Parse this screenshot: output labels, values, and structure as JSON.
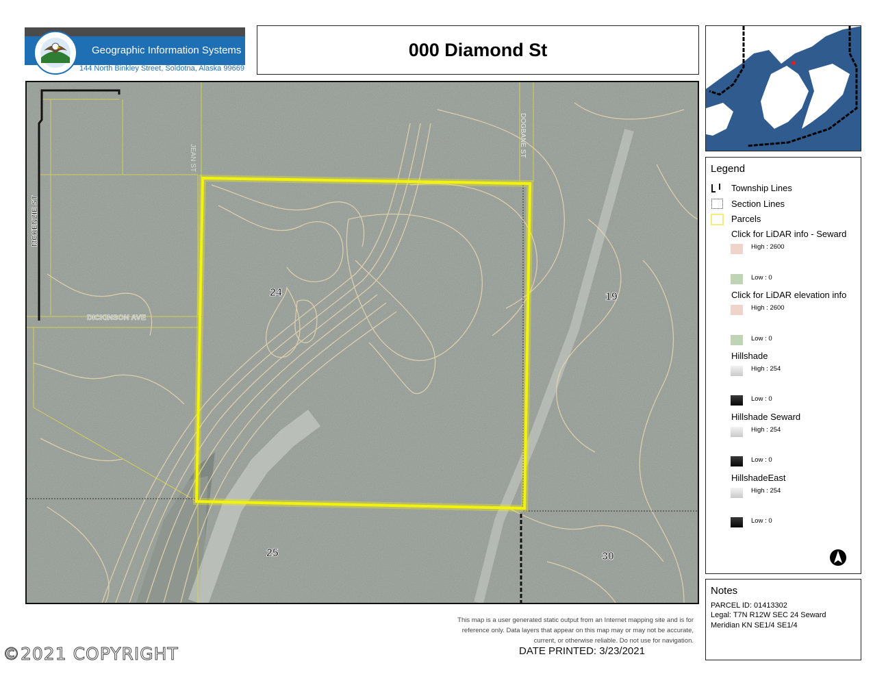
{
  "header": {
    "logo_text": "Geographic Information Systems",
    "address": "144 North Binkley Street, Soldotna, Alaska 99669",
    "seal_text_top": "KENAI PENINSULA",
    "seal_text_bottom": "BOROUGH",
    "title": "000 Diamond St"
  },
  "map": {
    "streets": [
      "JEAN ST",
      "DOGBANE ST",
      "MCKENZIE ST",
      "DICKINSON AVE"
    ],
    "section_labels": [
      "24",
      "19",
      "25",
      "30"
    ],
    "colors": {
      "parcel_highlight": "#f2f20f",
      "parcel_lines": "#d8d84a",
      "contours": "#e8d7b0",
      "terrain": "#8f958f",
      "water": "#2f5b8f"
    }
  },
  "legend": {
    "title": "Legend",
    "items": [
      {
        "label": "Township Lines"
      },
      {
        "label": "Section Lines"
      },
      {
        "label": "Parcels"
      },
      {
        "label": "Click for LiDAR info - Seward",
        "high": "High : 2600",
        "low": "Low : 0"
      },
      {
        "label": "Click for LiDAR elevation info",
        "high": "High : 2600",
        "low": "Low : 0"
      },
      {
        "label": "Hillshade",
        "high": "High : 254",
        "low": "Low : 0"
      },
      {
        "label": "Hillshade Seward",
        "high": "High : 254",
        "low": "Low : 0"
      },
      {
        "label": "HillshadeEast",
        "high": "High : 254",
        "low": "Low : 0"
      }
    ]
  },
  "notes": {
    "title": "Notes",
    "lines": [
      "PARCEL ID: 01413302",
      "Legal: T7N R12W SEC 24 Seward",
      "Meridian KN SE1/4 SE1/4"
    ]
  },
  "footer": {
    "disclaimer": [
      "This map is a user generated static output from an Internet mapping site and is for",
      "reference only. Data layers that appear on this map may or may not be accurate,",
      "current, or otherwise reliable. Do not use for navigation."
    ],
    "date_printed": "DATE PRINTED:  3/23/2021",
    "copyright": "©2021 COPYRIGHT"
  }
}
